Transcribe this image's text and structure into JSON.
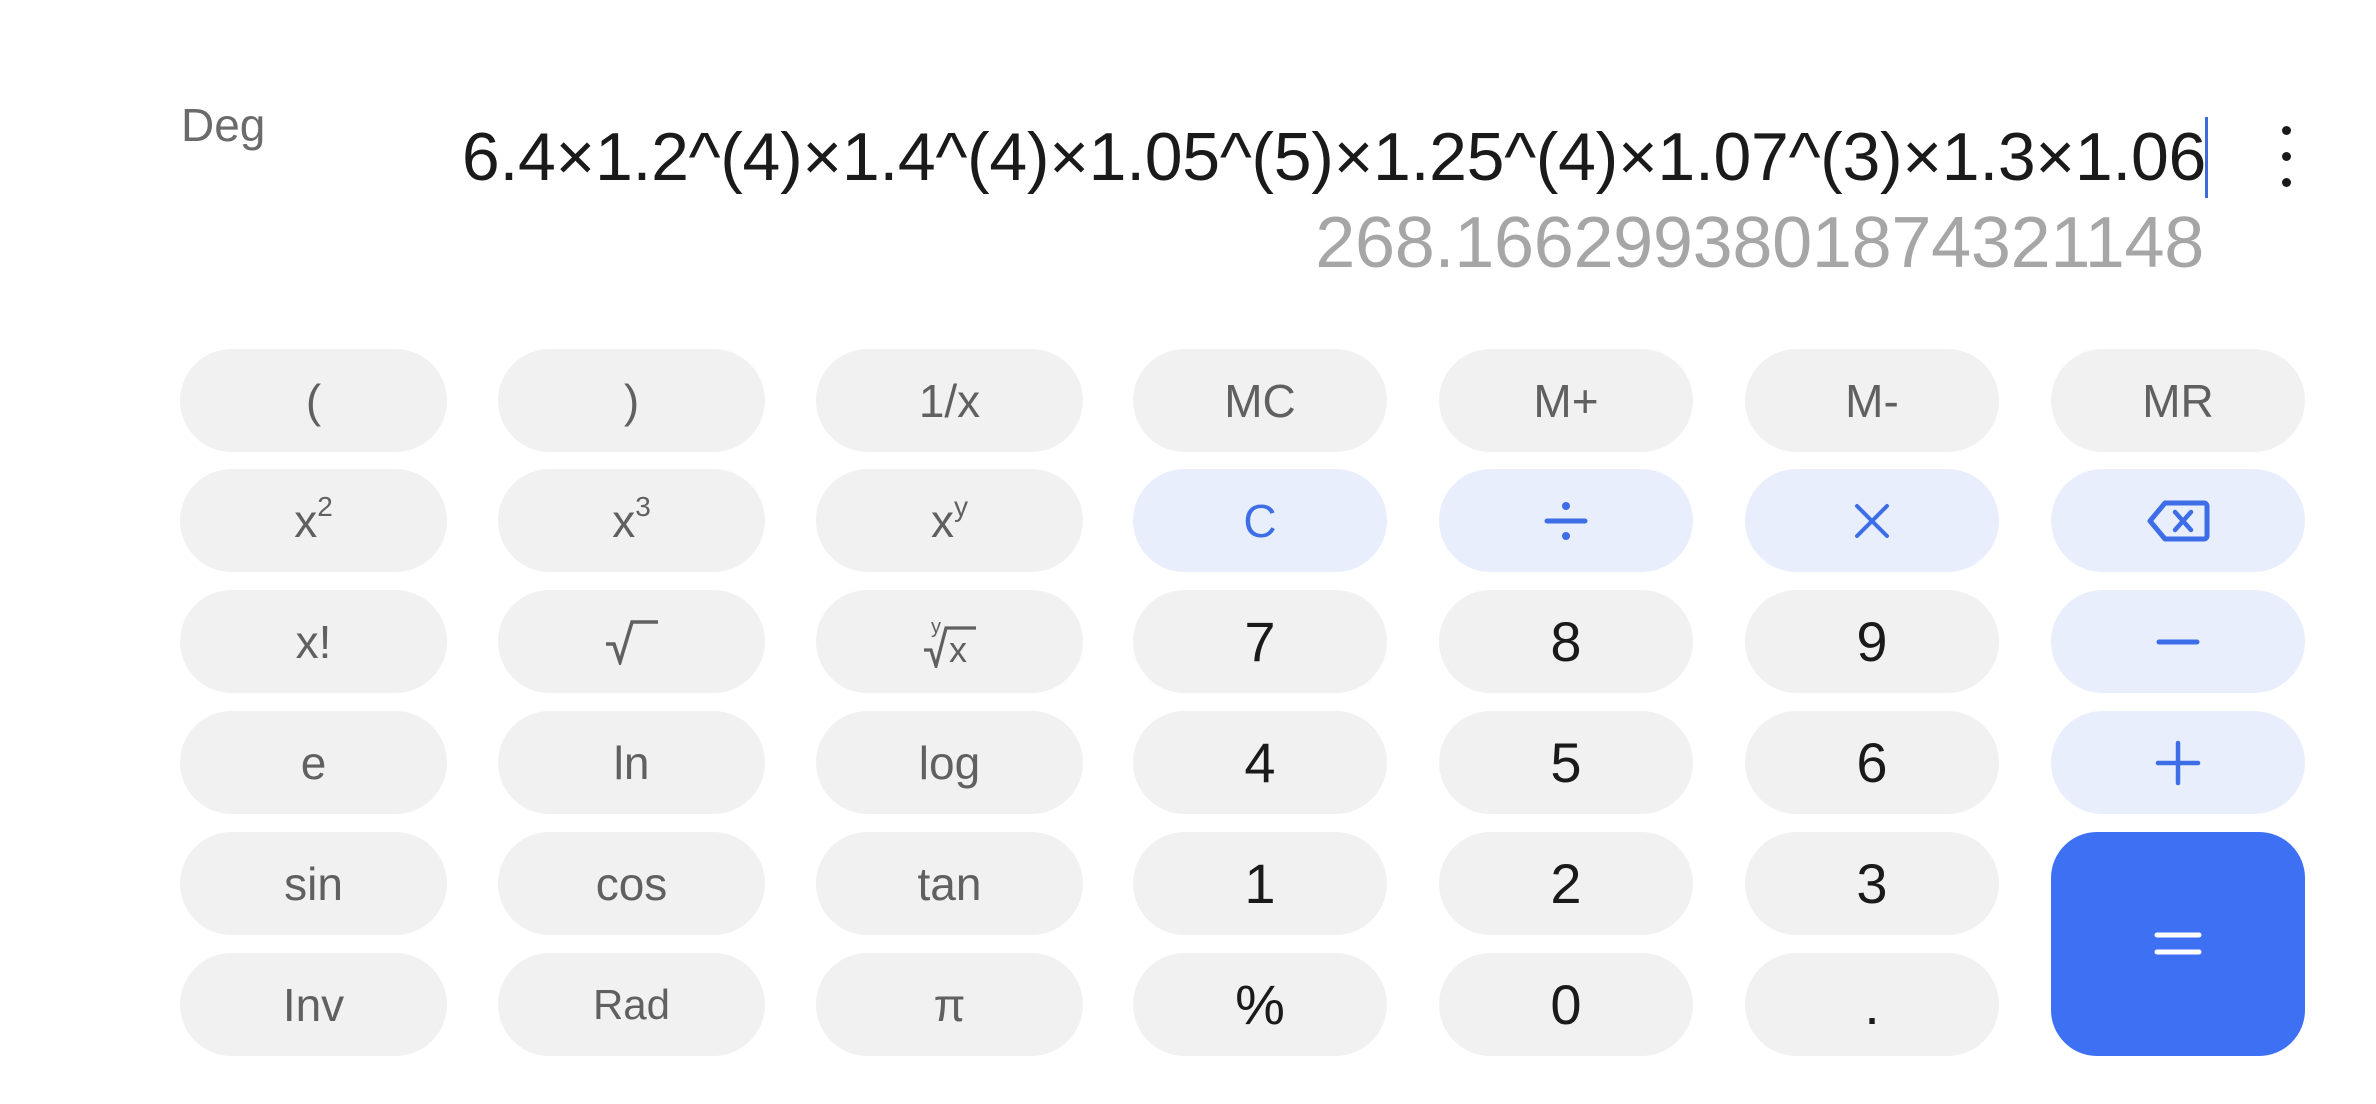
{
  "display": {
    "angle_mode": "Deg",
    "expression": "6.4×1.2^(4)×1.4^(4)×1.05^(5)×1.25^(4)×1.07^(3)×1.3×1.06",
    "result": "268.1662993801874321148",
    "more_icon": "more-vertical-icon"
  },
  "colors": {
    "accent": "#3d70f3",
    "operator_bg": "#e8eefc",
    "operator_fg": "#3d6ee8",
    "key_bg": "#f1f1f1",
    "result_text": "#a6a6a6",
    "cursor": "#3d6cd8"
  },
  "keys": {
    "open_paren": "(",
    "close_paren": ")",
    "reciprocal": "1/x",
    "mc": "MC",
    "m_plus": "M+",
    "m_minus": "M-",
    "mr": "MR",
    "square_base": "x",
    "square_exp": "2",
    "cube_base": "x",
    "cube_exp": "3",
    "power_base": "x",
    "power_exp": "y",
    "clear": "C",
    "divide_icon": "divide-icon",
    "multiply_icon": "multiply-icon",
    "backspace_icon": "backspace-icon",
    "factorial": "x!",
    "sqrt_icon": "square-root-icon",
    "yroot_icon": "y-root-icon",
    "d7": "7",
    "d8": "8",
    "d9": "9",
    "subtract_icon": "minus-icon",
    "e": "e",
    "ln": "ln",
    "log": "log",
    "d4": "4",
    "d5": "5",
    "d6": "6",
    "add_icon": "plus-icon",
    "sin": "sin",
    "cos": "cos",
    "tan": "tan",
    "d1": "1",
    "d2": "2",
    "d3": "3",
    "equals_icon": "equals-icon",
    "inv": "Inv",
    "rad": "Rad",
    "pi": "π",
    "percent": "%",
    "d0": "0",
    "decimal": "."
  }
}
